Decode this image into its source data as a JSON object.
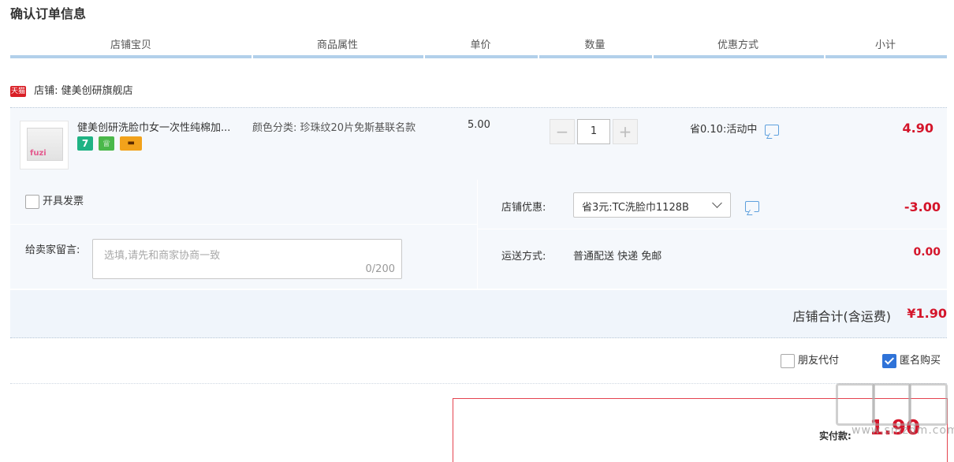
{
  "page": {
    "title": "确认订单信息"
  },
  "table_header": {
    "columns": [
      "店铺宝贝",
      "商品属性",
      "单价",
      "数量",
      "优惠方式",
      "小计"
    ]
  },
  "shop": {
    "platform_badge": "天猫",
    "label": "店铺:",
    "name": "健美创研旗舰店"
  },
  "item": {
    "thumbnail_brand": "fuzi",
    "title": "健美创研洗脸巾女一次性纯棉加...",
    "sku_label": "颜色分类:",
    "sku_value": "珍珠纹20片免斯基联名款",
    "unit_price": "5.00",
    "quantity": "1",
    "qty_minus": "−",
    "qty_plus": "+",
    "discount": "省0.10:活动中",
    "subtotal": "4.90",
    "badges": [
      "7",
      "♕",
      "▬"
    ]
  },
  "options": {
    "invoice_label": "开具发票",
    "message_label": "给卖家留言:",
    "message_placeholder": "选填,请先和商家协商一致",
    "message_count": "0/200",
    "shop_promo_label": "店铺优惠:",
    "shop_promo_value": "省3元:TC洗脸巾1128B",
    "shop_promo_amount": "-3.00",
    "shipping_label": "运送方式:",
    "shipping_value": "普通配送 快递 免邮",
    "shipping_fee": "0.00"
  },
  "totals": {
    "shop_total_label": "店铺合计(含运费)",
    "shop_total_amount": "¥1.90"
  },
  "extra": {
    "friend_pay_label": "朋友代付",
    "anonymous_label": "匿名购买",
    "anonymous_checked": true
  },
  "payment": {
    "label": "实付款:",
    "amount": "1.90"
  },
  "watermark": {
    "text": "www.smzdm.com"
  },
  "colors": {
    "accent_red": "#d4152a",
    "header_bar": "#b2d0ea",
    "panel_bg": "#f5f8fc",
    "checkbox_blue": "#2f73d8"
  }
}
